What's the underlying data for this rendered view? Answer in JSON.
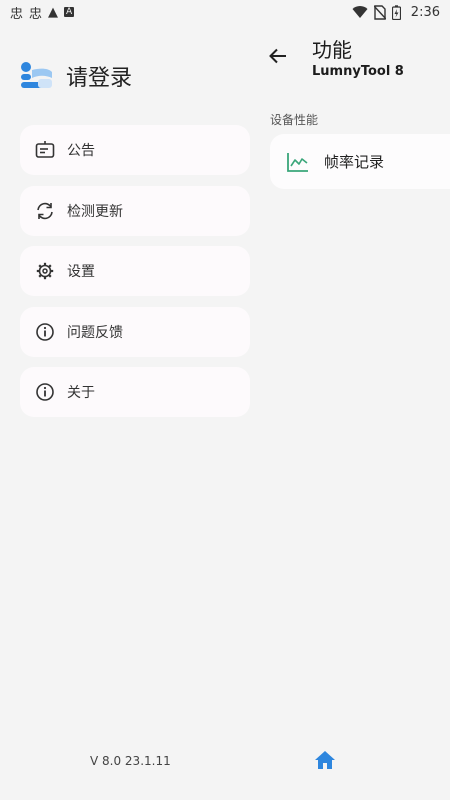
{
  "status_bar": {
    "left_icons": [
      "app-notification-icon",
      "app-notification-icon",
      "warning-icon",
      "text-icon"
    ],
    "left_glyphs": [
      "忠",
      "忠",
      "▲",
      "A"
    ],
    "time": "2:36",
    "right_icons": [
      "wifi-icon",
      "no-sim-icon",
      "battery-icon"
    ]
  },
  "drawer": {
    "login_label": "请登录",
    "menu": [
      {
        "label": "公告",
        "icon": "announcement-icon"
      },
      {
        "label": "检测更新",
        "icon": "refresh-icon"
      },
      {
        "label": "设置",
        "icon": "gear-icon"
      },
      {
        "label": "问题反馈",
        "icon": "info-icon"
      },
      {
        "label": "关于",
        "icon": "info-icon"
      }
    ],
    "version": "V 8.0 23.1.11"
  },
  "content": {
    "title": "功能",
    "subtitle": "LumnyTool 8",
    "section_label": "设备性能",
    "feature_label": "帧率记录",
    "feature_icon": "chart-line-icon"
  },
  "colors": {
    "background": "#f4f4f4",
    "card": "#fdfafc",
    "accent_blue": "#2e86de",
    "chart_green": "#3aa67a",
    "text": "#1c1c1c"
  }
}
